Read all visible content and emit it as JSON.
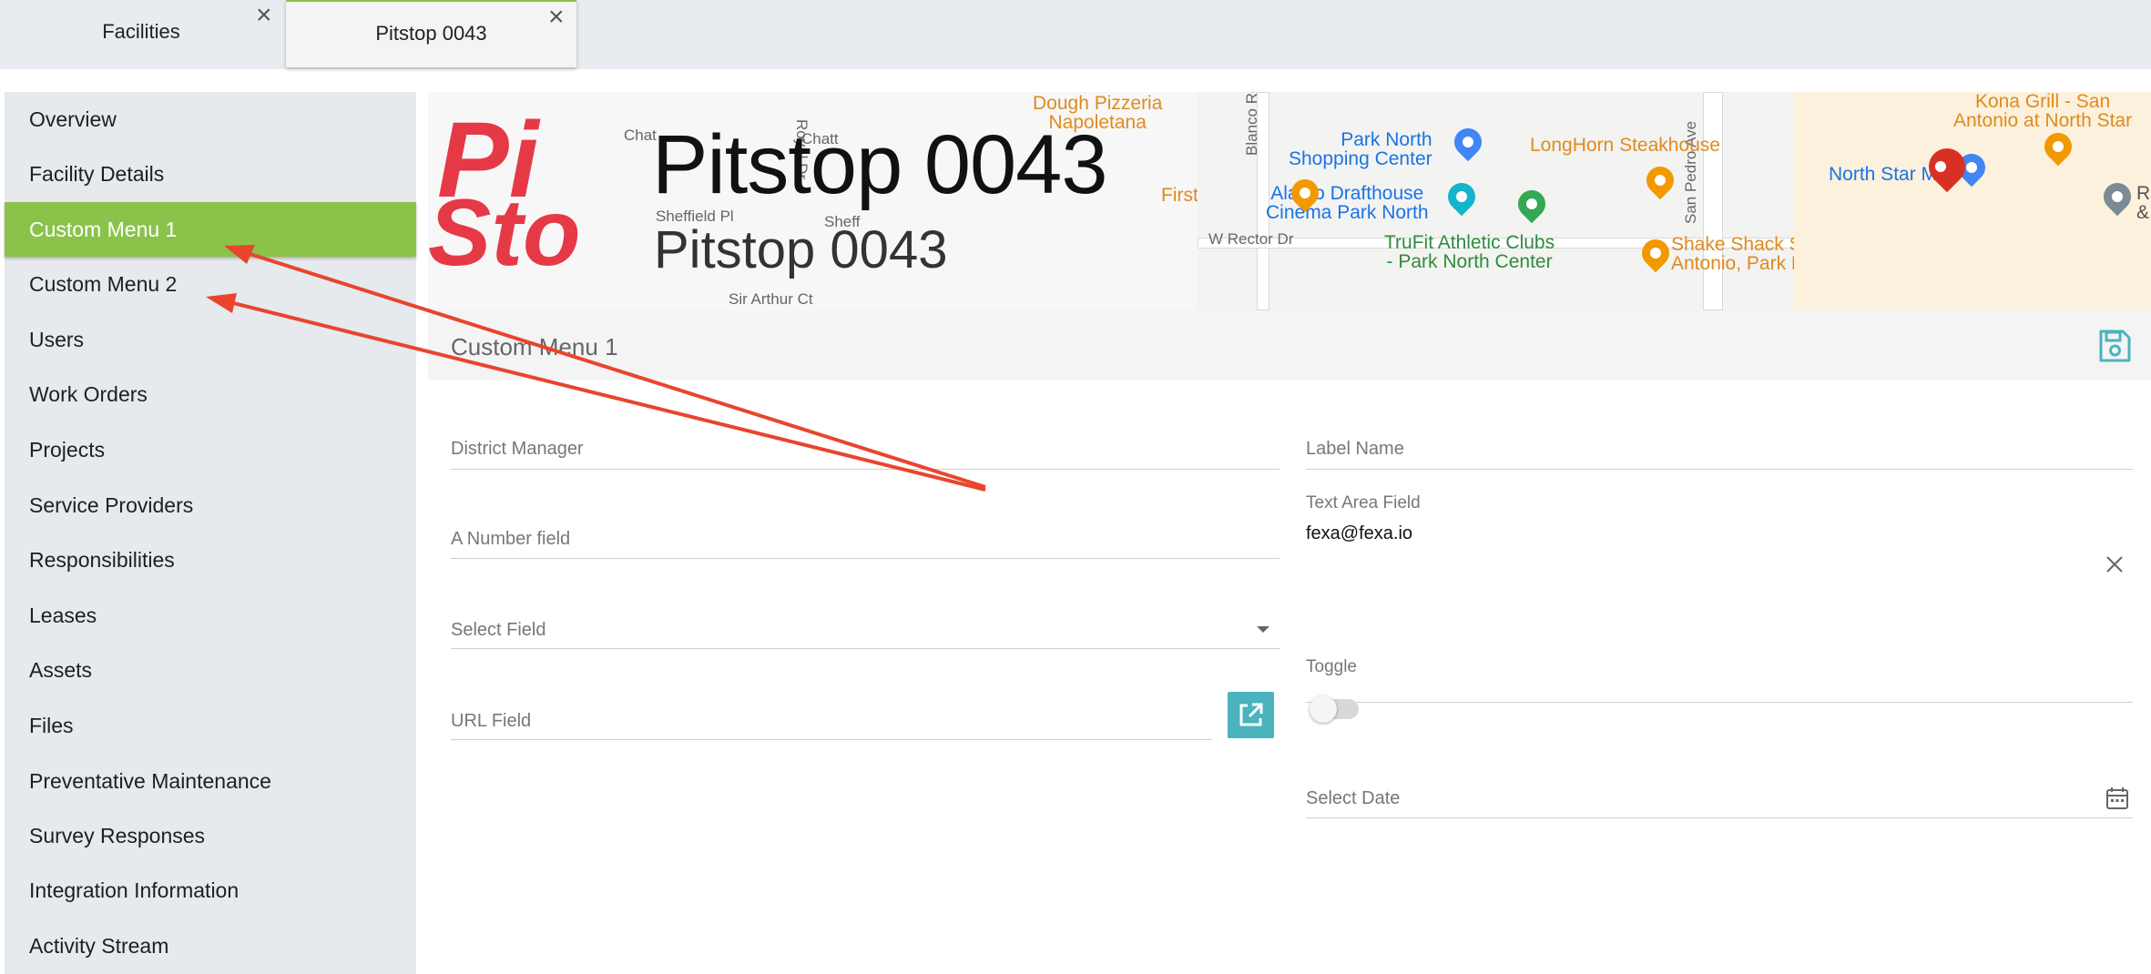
{
  "tabs": [
    {
      "label": "Facilities",
      "close": "×"
    },
    {
      "label": "Pitstop 0043",
      "close": "×"
    }
  ],
  "sidebar": {
    "items": [
      {
        "label": "Overview"
      },
      {
        "label": "Facility Details"
      },
      {
        "label": "Custom Menu 1",
        "active": true
      },
      {
        "label": "Custom Menu 2"
      },
      {
        "label": "Users"
      },
      {
        "label": "Work Orders"
      },
      {
        "label": "Projects"
      },
      {
        "label": "Service Providers"
      },
      {
        "label": "Responsibilities"
      },
      {
        "label": "Leases"
      },
      {
        "label": "Assets"
      },
      {
        "label": "Files"
      },
      {
        "label": "Preventative Maintenance"
      },
      {
        "label": "Survey Responses"
      },
      {
        "label": "Integration Information"
      },
      {
        "label": "Activity Stream"
      }
    ]
  },
  "header": {
    "title": "Pitstop 0043",
    "subtitle": "Pitstop 0043",
    "logo_text": "Pit Sto"
  },
  "map": {
    "places": {
      "dough_pizzeria": "Dough Pizzeria\nNapoletana",
      "first_watch": "First Watch",
      "park_north": "Park North\nShopping Center",
      "alamo": "Alamo Drafthouse\nCinema Park North",
      "trufit": "TruFit Athletic Clubs\n- Park North Center",
      "longhorn": "LongHorn Steakhouse",
      "shake_shack": "Shake Shack San\nAntonio, Park North",
      "kona_grill": "Kona Grill - San\nAntonio at North Star",
      "north_star": "North Star Ma",
      "edge": "R\n&"
    },
    "streets": {
      "sheffield": "Sheffield Pl",
      "sir_arthur": "Sir Arthur Ct",
      "chatt1": "Chat",
      "chatt2": "Chatt",
      "sheff2": "Sheff",
      "royal": "Royal Dr",
      "blanco": "Blanco Rd",
      "rector": "W Rector Dr",
      "san_pedro": "San Pedro Ave"
    }
  },
  "section": {
    "title": "Custom Menu 1"
  },
  "form": {
    "district_manager": {
      "label": "District Manager",
      "value": ""
    },
    "label_name": {
      "label": "Label Name",
      "value": ""
    },
    "number_field": {
      "label": "A Number field",
      "value": ""
    },
    "text_area": {
      "label": "Text Area Field",
      "value": "fexa@fexa.io"
    },
    "select_field": {
      "label": "Select Field",
      "value": ""
    },
    "url_field": {
      "label": "URL Field",
      "value": ""
    },
    "toggle": {
      "label": "Toggle",
      "on": false
    },
    "select_date": {
      "label": "Select Date",
      "value": ""
    }
  },
  "icons": {
    "save": "save-icon",
    "clear": "close-icon",
    "dropdown": "caret-down-icon",
    "external": "external-link-icon",
    "calendar": "calendar-icon"
  },
  "colors": {
    "accent": "#8bc34a",
    "teal": "#4ab3bd",
    "logo_red": "#e63946",
    "annotation_red": "#e8452c"
  }
}
